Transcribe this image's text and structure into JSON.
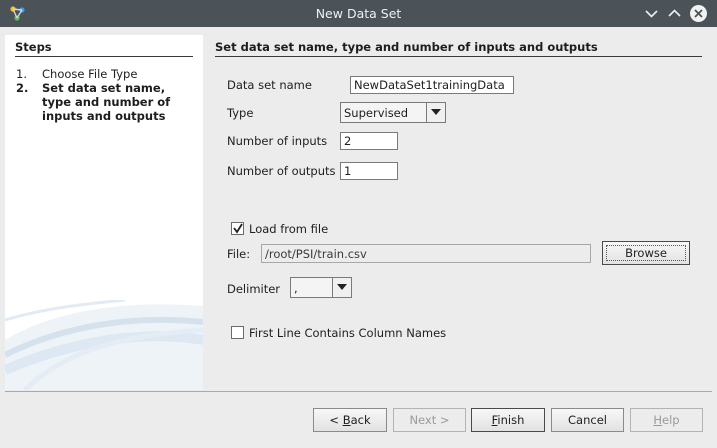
{
  "window": {
    "title": "New Data Set",
    "app_icon": "app-logo-icon",
    "controls": [
      "minimize-icon",
      "maximize-icon",
      "close-icon"
    ]
  },
  "steps": {
    "heading": "Steps",
    "items": [
      {
        "num": "1.",
        "label": "Choose File Type",
        "current": false
      },
      {
        "num": "2.",
        "label": "Set data set name, type and number of inputs and outputs",
        "current": true
      }
    ]
  },
  "form": {
    "section_title": "Set data set name, type and number of inputs and outputs",
    "name_label": "Data set name",
    "name_value": "NewDataSet1trainingData",
    "type_label": "Type",
    "type_value": "Supervised",
    "inputs_label": "Number of inputs",
    "inputs_value": "2",
    "outputs_label": "Number of outputs",
    "outputs_value": "1",
    "load_label": "Load from file",
    "load_checked": true,
    "file_label": "File:",
    "file_value": "/root/PSI/train.csv",
    "browse_label": "Browse",
    "delimiter_label": "Delimiter",
    "delimiter_value": ",",
    "first_line_label": "First Line Contains Column Names",
    "first_line_checked": false
  },
  "buttons": {
    "back": {
      "prefix": "< ",
      "mnemonic": "B",
      "rest": "ack"
    },
    "next": "Next >",
    "finish": {
      "mnemonic": "F",
      "rest": "inish"
    },
    "cancel": "Cancel",
    "help": {
      "mnemonic": "H",
      "rest": "elp"
    }
  },
  "colors": {
    "titlebar": "#4b5258",
    "panel": "#ececec",
    "steps_bg": "#ffffff",
    "swoosh": "#dbe7f1"
  }
}
